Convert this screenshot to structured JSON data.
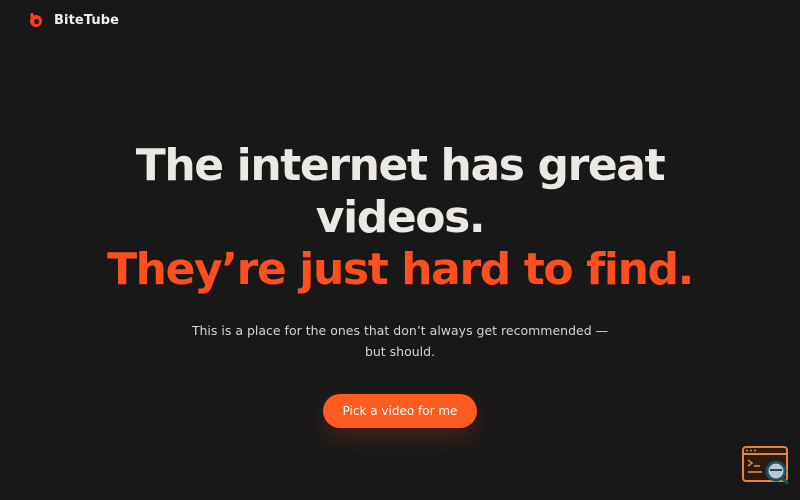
{
  "header": {
    "brand_name": "BiteTube",
    "logo_icon": "bitetube-logo-icon"
  },
  "hero": {
    "headline_line_1": "The internet has great",
    "headline_line_2": "videos.",
    "headline_line_3": "They’re just hard to find.",
    "subheadline": "This is a place for the ones that don’t always get recommended — but should.",
    "cta_label": "Pick a video for me"
  },
  "widget": {
    "icon": "browser-search-icon"
  },
  "colors": {
    "background": "#181818",
    "accent": "#ff4f1f",
    "text": "#ece8e4",
    "widget": "#e7843e"
  }
}
